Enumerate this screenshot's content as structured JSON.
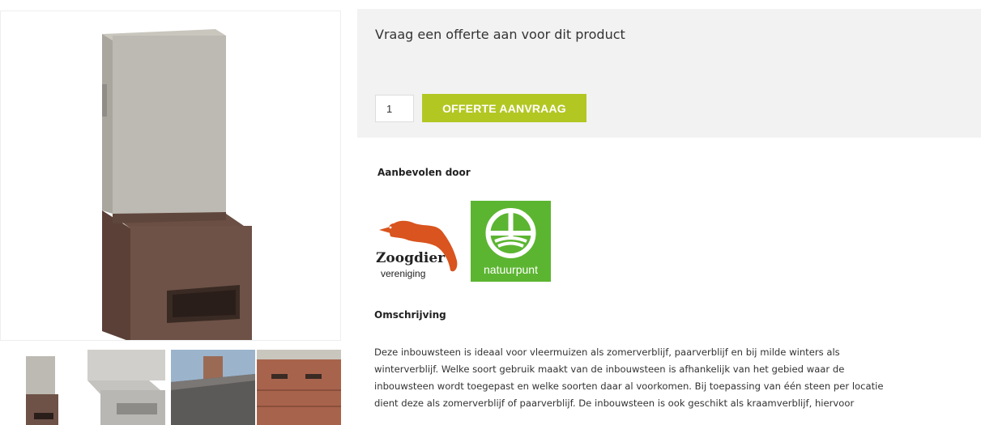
{
  "offer": {
    "title": "Vraag een offerte aan voor dit product",
    "quantity": "1",
    "button_label": "OFFERTE AANVRAAG"
  },
  "recommended": {
    "heading": "Aanbevolen door",
    "logos": [
      {
        "name": "zoogdier-vereniging",
        "line1": "Zoogdier",
        "line2": "vereniging",
        "color": "#d9541e"
      },
      {
        "name": "natuurpunt",
        "text": "natuurpunt",
        "color": "#5cb531"
      }
    ]
  },
  "description": {
    "heading": "Omschrijving",
    "lines": [
      "Deze inbouwsteen is ideaal voor vleermuizen als zomerverblijf, paarverblijf en bij milde winters als",
      "winterverblijf. Welke soort gebruik maakt van de inbouwsteen is afhankelijk van het gebied waar de",
      "inbouwsteen wordt toegepast en welke soorten daar al voorkomen. Bij toepassing van één steen per locatie",
      "dient deze als zomerverblijf of paarverblijf. De inbouwsteen is ook geschikt als kraamverblijf, hiervoor"
    ]
  },
  "colors": {
    "button": "#b3c723",
    "panel": "#f2f2f2"
  }
}
